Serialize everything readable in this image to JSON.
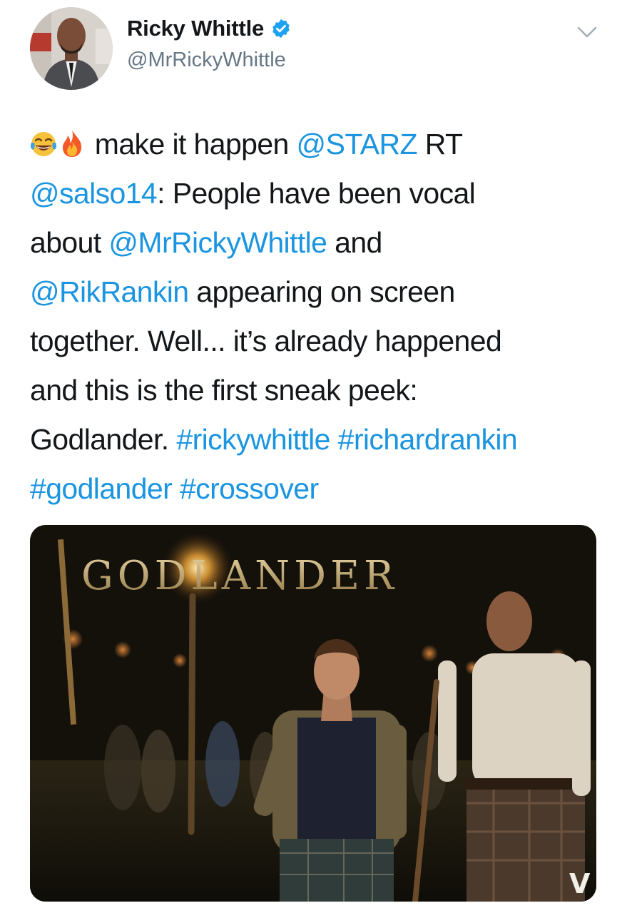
{
  "user": {
    "display_name": "Ricky Whittle",
    "handle": "@MrRickyWhittle",
    "verified": true
  },
  "tweet": {
    "emojis": [
      "face-with-tears-of-joy",
      "fire"
    ],
    "segments": {
      "s1": "make it happen ",
      "s2": "@STARZ",
      "s3": " RT",
      "s4": "@salso14",
      "s5": ": People have been vocal",
      "s6": "about ",
      "s7": "@MrRickyWhittle",
      "s8": " and",
      "s9": "@RikRankin",
      "s10": " appearing on screen",
      "s11": "together. Well... it’s already happened",
      "s12": "and this is the first sneak peek:",
      "s13": "Godlander. ",
      "s14": "#rickywhittle",
      "s15": " ",
      "s16": "#richardrankin",
      "s17": "#godlander",
      "s18": " ",
      "s19": "#crossover"
    }
  },
  "media": {
    "title_text": "GODLANDER",
    "corner_mark": "V"
  },
  "colors": {
    "link": "#1b95e0",
    "verified": "#1da1f2",
    "secondary_text": "#657786"
  },
  "icons": {
    "verified": "verified-badge-icon",
    "caret": "chevron-down-icon"
  }
}
